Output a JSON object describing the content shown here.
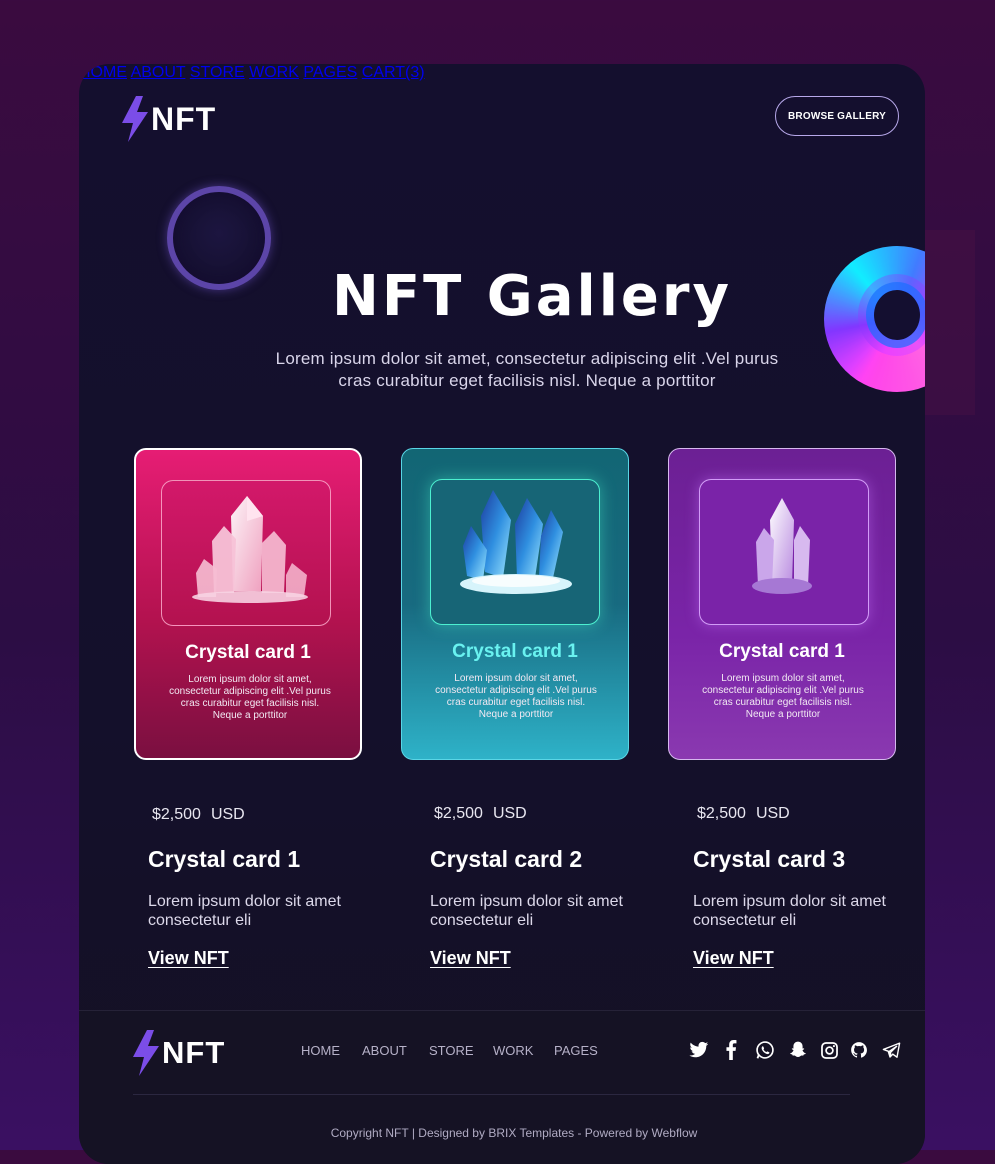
{
  "header": {
    "logo_text": "NFT",
    "nav": [
      "HOME",
      "ABOUT",
      "STORE",
      "WORK",
      "PAGES",
      "CART(3)"
    ],
    "browse_label": "BROWSE GALLERY"
  },
  "hero": {
    "title": "NFT Gallery",
    "subtitle": "Lorem ipsum dolor sit amet, consectetur adipiscing elit .Vel purus cras curabitur eget facilisis nisl. Neque a porttitor"
  },
  "cards": [
    {
      "title": "Crystal card 1",
      "desc": "Lorem ipsum dolor sit amet, consectetur adipiscing elit .Vel purus cras curabitur eget facilisis nisl. Neque a porttitor"
    },
    {
      "title": "Crystal card 1",
      "desc": "Lorem ipsum dolor sit amet, consectetur adipiscing elit .Vel purus cras curabitur eget facilisis nisl. Neque a porttitor"
    },
    {
      "title": "Crystal card 1",
      "desc": "Lorem ipsum dolor sit amet, consectetur adipiscing elit .Vel purus cras curabitur eget facilisis nisl. Neque a porttitor"
    }
  ],
  "items": [
    {
      "price": "$2,500",
      "currency": "USD",
      "name": "Crystal card 1",
      "desc": "Lorem ipsum dolor sit amet consectetur  eli",
      "link": "View NFT"
    },
    {
      "price": "$2,500",
      "currency": "USD",
      "name": "Crystal card 2",
      "desc": "Lorem ipsum dolor sit amet consectetur  eli",
      "link": "View NFT"
    },
    {
      "price": "$2,500",
      "currency": "USD",
      "name": "Crystal card 3",
      "desc": "Lorem ipsum dolor sit amet consectetur  eli",
      "link": "View NFT"
    }
  ],
  "footer": {
    "logo_text": "NFT",
    "nav": [
      "HOME",
      "ABOUT",
      "STORE",
      "WORK",
      "PAGES"
    ],
    "social_icons": [
      "twitter-icon",
      "facebook-icon",
      "whatsapp-icon",
      "snapchat-icon",
      "instagram-icon",
      "github-icon",
      "telegram-icon"
    ],
    "copyright": "Copyright   NFT  | Designed by BRIX Templates - Powered by Webflow"
  },
  "colors": {
    "accent_purple": "#7b4de8",
    "card1": "#e61d74",
    "card2": "#186a80",
    "card3": "#7a24a8"
  }
}
